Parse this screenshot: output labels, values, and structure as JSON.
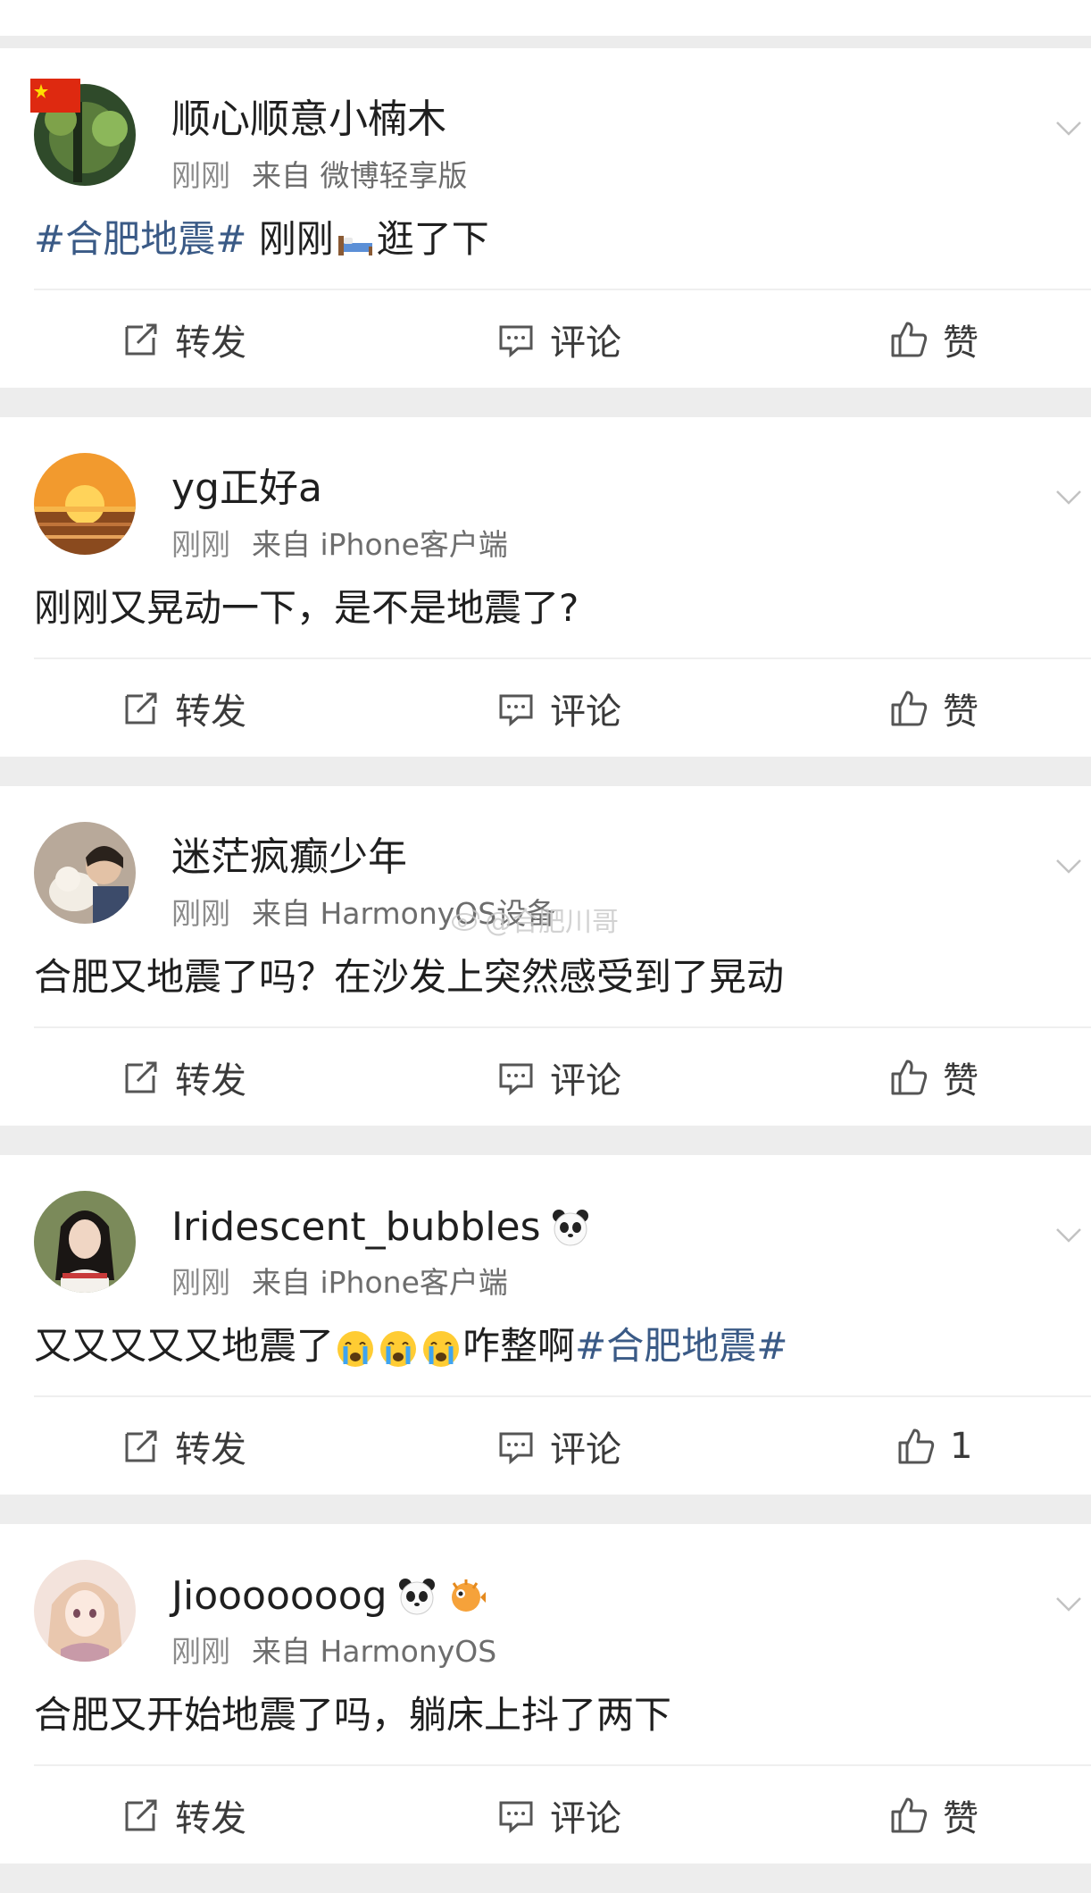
{
  "posts": [
    {
      "username": "顺心顺意小楠木",
      "time": "刚刚",
      "source": "来自 微博轻享版",
      "segments": [
        {
          "type": "hashtag",
          "text": "#合肥地震#"
        },
        {
          "type": "text",
          "text": " 刚刚"
        },
        {
          "type": "emoji",
          "name": "bed-emoji"
        },
        {
          "type": "text",
          "text": "逛了下"
        }
      ],
      "actions": {
        "repost": "转发",
        "comment": "评论",
        "like": "赞"
      }
    },
    {
      "username": "yg正好a",
      "time": "刚刚",
      "source": "来自 iPhone客户端",
      "segments": [
        {
          "type": "text",
          "text": "刚刚又晃动一下，是不是地震了?"
        }
      ],
      "actions": {
        "repost": "转发",
        "comment": "评论",
        "like": "赞"
      }
    },
    {
      "username": "迷茫疯癫少年",
      "time": "刚刚",
      "source": "来自 HarmonyOS设备",
      "segments": [
        {
          "type": "text",
          "text": "合肥又地震了吗？在沙发上突然感受到了晃动"
        }
      ],
      "actions": {
        "repost": "转发",
        "comment": "评论",
        "like": "赞"
      }
    },
    {
      "username": "Iridescent_bubbles",
      "badges": [
        "panda-emoji"
      ],
      "time": "刚刚",
      "source": "来自 iPhone客户端",
      "segments": [
        {
          "type": "text",
          "text": "又又又又又地震了"
        },
        {
          "type": "emoji",
          "name": "crying-emoji"
        },
        {
          "type": "emoji",
          "name": "crying-emoji"
        },
        {
          "type": "emoji",
          "name": "crying-emoji"
        },
        {
          "type": "text",
          "text": "咋整啊"
        },
        {
          "type": "hashtag",
          "text": "#合肥地震#"
        }
      ],
      "actions": {
        "repost": "转发",
        "comment": "评论",
        "like": "1"
      }
    },
    {
      "username": "Jiooooooog",
      "badges": [
        "panda-emoji",
        "pufferfish-emoji"
      ],
      "time": "刚刚",
      "source": "来自 HarmonyOS",
      "segments": [
        {
          "type": "text",
          "text": "合肥又开始地震了吗，躺床上抖了两下"
        }
      ],
      "actions": {
        "repost": "转发",
        "comment": "评论",
        "like": "赞"
      }
    }
  ],
  "watermark": "@合肥川哥",
  "colors": {
    "hashtag": "#3a5a86",
    "meta": "#8c8c8c",
    "separator": "#ededed"
  }
}
